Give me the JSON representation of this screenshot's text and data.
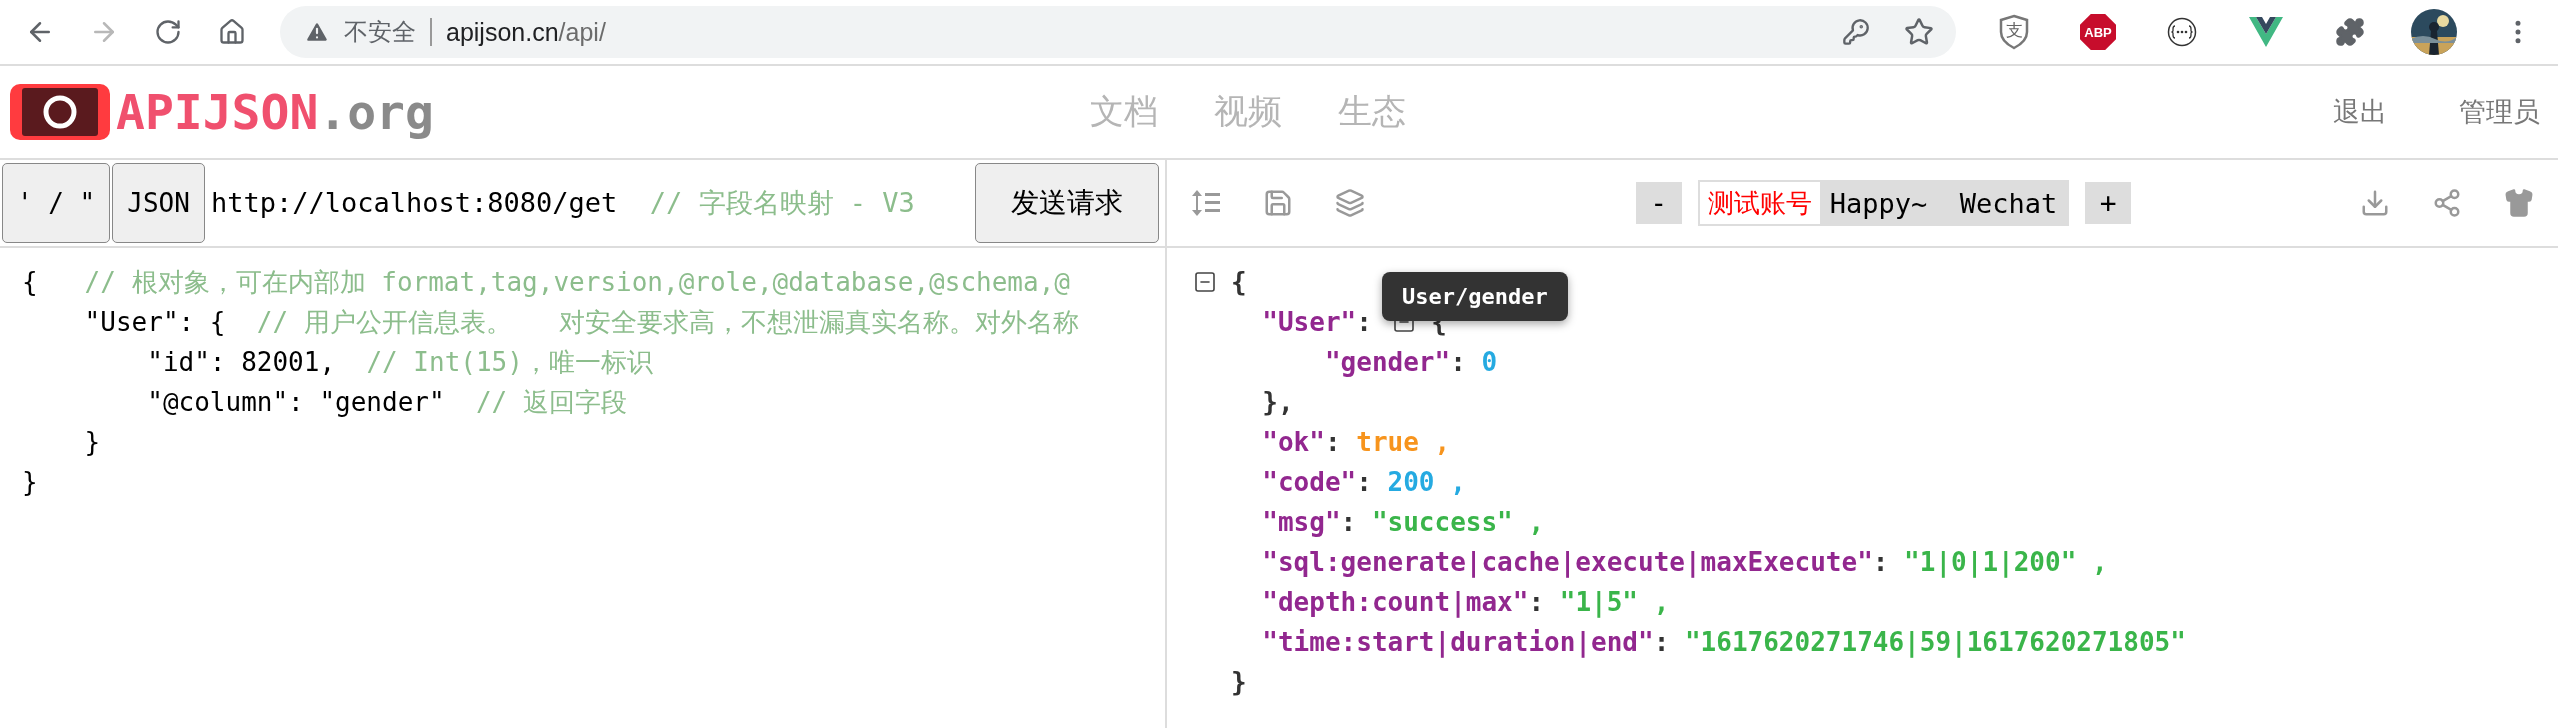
{
  "browser": {
    "nav": [
      {
        "kind": "back",
        "disabled": false
      },
      {
        "kind": "forward",
        "disabled": true
      },
      {
        "kind": "reload",
        "disabled": false
      },
      {
        "kind": "home",
        "disabled": false
      }
    ],
    "address": {
      "security": "不安全",
      "host": "apijson.cn",
      "path": "/api/"
    },
    "extensions": [
      {
        "kind": "shield",
        "label": "支"
      },
      {
        "kind": "abp",
        "label": "ABP"
      },
      {
        "kind": "braces"
      },
      {
        "kind": "vue"
      },
      {
        "kind": "puzzle"
      },
      {
        "kind": "avatar"
      },
      {
        "kind": "menu"
      }
    ]
  },
  "site": {
    "logo": {
      "name": "APIJSON",
      "suffix": ".org"
    },
    "nav": [
      "文档",
      "视频",
      "生态"
    ],
    "links": [
      "退出",
      "管理员"
    ]
  },
  "request": {
    "mode_buttons": [
      "' / \"",
      "JSON"
    ],
    "url": "http://localhost:8080/get",
    "url_comment": "// 字段名映射 - V3",
    "send": "发送请求",
    "lines": [
      [
        {
          "kind": "punct",
          "text": "{"
        },
        {
          "kind": "comment",
          "text": "   // 根对象，可在内部加 format,tag,version,@role,@database,@schema,@"
        }
      ],
      [
        {
          "kind": "punct",
          "text": "    \"User\": {"
        },
        {
          "kind": "comment",
          "text": "  // 用户公开信息表。   对安全要求高，不想泄漏真实名称。对外名称"
        }
      ],
      [
        {
          "kind": "punct",
          "text": "        \"id\": 82001,"
        },
        {
          "kind": "comment",
          "text": "  // Int(15)，唯一标识"
        }
      ],
      [
        {
          "kind": "punct",
          "text": "        \"@column\": \"gender\""
        },
        {
          "kind": "comment",
          "text": "  // 返回字段"
        }
      ],
      [
        {
          "kind": "punct",
          "text": "    }"
        }
      ],
      [
        {
          "kind": "punct",
          "text": "}"
        }
      ]
    ]
  },
  "response": {
    "account": {
      "minus": "-",
      "label": "测试账号",
      "name": "Happy~  Wechat",
      "plus": "+"
    },
    "tooltip": "User/gender",
    "lines": [
      {
        "tokens": [
          {
            "kind": "toggle"
          },
          {
            "kind": "punct",
            "text": "{"
          }
        ]
      },
      {
        "tokens": [
          {
            "kind": "key",
            "text": "  \"User\""
          },
          {
            "kind": "punct",
            "text": ": "
          },
          {
            "kind": "toggle"
          },
          {
            "kind": "punct",
            "text": " {"
          }
        ]
      },
      {
        "tokens": [
          {
            "kind": "key",
            "text": "      \"gender\""
          },
          {
            "kind": "punct",
            "text": ": "
          },
          {
            "kind": "number",
            "text": "0"
          }
        ]
      },
      {
        "tokens": [
          {
            "kind": "punct",
            "text": "  },"
          }
        ]
      },
      {
        "tokens": [
          {
            "kind": "key",
            "text": "  \"ok\""
          },
          {
            "kind": "punct",
            "text": ": "
          },
          {
            "kind": "bool",
            "text": "true ,"
          }
        ]
      },
      {
        "tokens": [
          {
            "kind": "key",
            "text": "  \"code\""
          },
          {
            "kind": "punct",
            "text": ": "
          },
          {
            "kind": "number",
            "text": "200 ,"
          }
        ]
      },
      {
        "tokens": [
          {
            "kind": "key",
            "text": "  \"msg\""
          },
          {
            "kind": "punct",
            "text": ": "
          },
          {
            "kind": "string",
            "text": "\"success\" ,"
          }
        ]
      },
      {
        "tokens": [
          {
            "kind": "key",
            "text": "  \"sql:generate|cache|execute|maxExecute\""
          },
          {
            "kind": "punct",
            "text": ": "
          },
          {
            "kind": "string",
            "text": "\"1|0|1|200\" ,"
          }
        ]
      },
      {
        "tokens": [
          {
            "kind": "key",
            "text": "  \"depth:count|max\""
          },
          {
            "kind": "punct",
            "text": ": "
          },
          {
            "kind": "string",
            "text": "\"1|5\" ,"
          }
        ]
      },
      {
        "tokens": [
          {
            "kind": "key",
            "text": "  \"time:start|duration|end\""
          },
          {
            "kind": "punct",
            "text": ": "
          },
          {
            "kind": "string",
            "text": "\"1617620271746|59|1617620271805\""
          }
        ]
      },
      {
        "tokens": [
          {
            "kind": "punct",
            "text": "}"
          }
        ]
      }
    ]
  }
}
